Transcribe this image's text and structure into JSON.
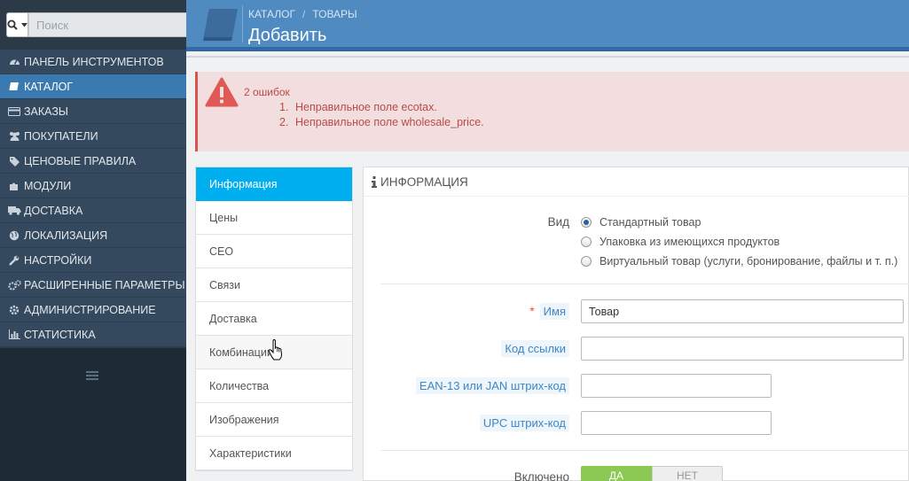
{
  "search": {
    "placeholder": "Поиск"
  },
  "sidebar": {
    "items": [
      {
        "label": "ПАНЕЛЬ ИНСТРУМЕНТОВ",
        "icon": "dashboard-icon",
        "active": false
      },
      {
        "label": "КАТАЛОГ",
        "icon": "book-icon",
        "active": true
      },
      {
        "label": "ЗАКАЗЫ",
        "icon": "credit-card-icon",
        "active": false
      },
      {
        "label": "ПОКУПАТЕЛИ",
        "icon": "users-icon",
        "active": false
      },
      {
        "label": "ЦЕНОВЫЕ ПРАВИЛА",
        "icon": "tags-icon",
        "active": false
      },
      {
        "label": "МОДУЛИ",
        "icon": "puzzle-icon",
        "active": false
      },
      {
        "label": "ДОСТАВКА",
        "icon": "truck-icon",
        "active": false
      },
      {
        "label": "ЛОКАЛИЗАЦИЯ",
        "icon": "globe-icon",
        "active": false
      },
      {
        "label": "НАСТРОЙКИ",
        "icon": "wrench-icon",
        "active": false
      },
      {
        "label": "РАСШИРЕННЫЕ ПАРАМЕТРЫ",
        "icon": "cogs-icon",
        "active": false
      },
      {
        "label": "АДМИНИСТРИРОВАНИЕ",
        "icon": "cog-icon",
        "active": false
      },
      {
        "label": "СТАТИСТИКА",
        "icon": "bar-chart-icon",
        "active": false
      }
    ]
  },
  "header": {
    "breadcrumb": [
      "КАТАЛОГ",
      "ТОВАРЫ"
    ],
    "breadcrumb_sep": "/",
    "title": "Добавить"
  },
  "alert": {
    "title": "2 ошибок",
    "errors": [
      {
        "num": "1.",
        "text": "Неправильное поле ecotax."
      },
      {
        "num": "2.",
        "text": "Неправильное поле wholesale_price."
      }
    ]
  },
  "tabs": [
    {
      "label": "Информация",
      "active": true
    },
    {
      "label": "Цены"
    },
    {
      "label": "СЕО"
    },
    {
      "label": "Связи"
    },
    {
      "label": "Доставка"
    },
    {
      "label": "Комбинации"
    },
    {
      "label": "Количества"
    },
    {
      "label": "Изображения"
    },
    {
      "label": "Характеристики"
    }
  ],
  "panel": {
    "heading": "ИНФОРМАЦИЯ",
    "type_label": "Вид",
    "type_options": [
      {
        "label": "Стандартный товар",
        "checked": true
      },
      {
        "label": "Упаковка из имеющихся продуктов",
        "checked": false
      },
      {
        "label": "Виртуальный товар (услуги, бронирование, файлы и т. п.)",
        "checked": false
      }
    ],
    "name_label": "Имя",
    "name_required": "*",
    "name_value": "Товар",
    "reference_label": "Код ссылки",
    "reference_value": "",
    "ean_label": "EAN-13 или JAN штрих-код",
    "ean_value": "",
    "upc_label": "UPC штрих-код",
    "upc_value": "",
    "enabled_label": "Включено",
    "enabled_yes": "ДА",
    "enabled_no": "НЕТ",
    "enabled_value": "ДА"
  },
  "colors": {
    "sidebar_bg": "#34495e",
    "sidebar_active": "#3a7ab0",
    "header_bg": "#4f8ac1",
    "tab_active": "#00aff0",
    "alert_bg": "#f2dede",
    "alert_text": "#b94a48",
    "toggle_yes": "#8bc954"
  }
}
